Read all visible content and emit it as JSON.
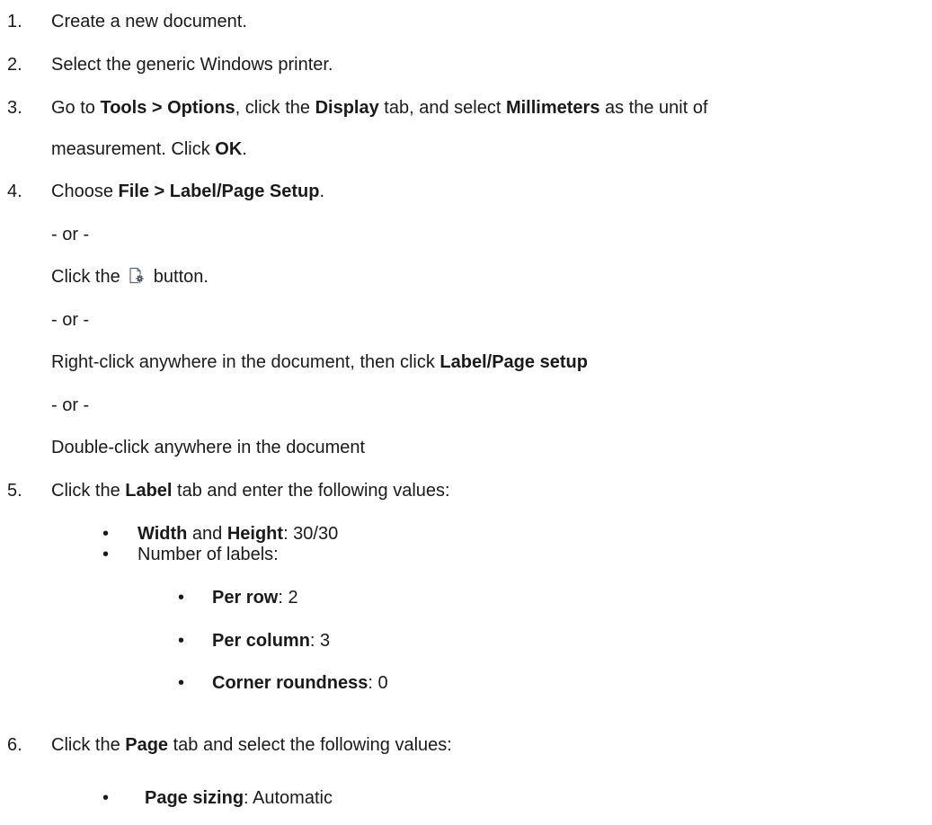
{
  "steps": [
    {
      "num": "1.",
      "text": "Create a new document."
    },
    {
      "num": "2.",
      "text": "Select the generic Windows printer."
    },
    {
      "num": "3.",
      "pre": "Go to ",
      "b1": "Tools > Options",
      "mid1": ", click the ",
      "b2": "Display",
      "mid2": " tab, and select ",
      "b3": "Millimeters",
      "post": " as the unit of",
      "line2_pre": "measurement. Click ",
      "line2_b": "OK",
      "line2_post": "."
    },
    {
      "num": "4.",
      "pre": "Choose ",
      "b": "File > Label/Page Setup",
      "post": ".",
      "or": "- or -",
      "click_pre": "Click the ",
      "click_post": " button.",
      "right_pre": "Right-click anywhere in the document, then click ",
      "right_b": "Label/Page setup",
      "double": "Double-click anywhere in the document"
    },
    {
      "num": "5.",
      "pre": "Click the ",
      "b": "Label",
      "post": " tab and enter the following values:",
      "bullets": {
        "wh_b1": "Width",
        "wh_mid": " and ",
        "wh_b2": "Height",
        "wh_post": ": 30/30",
        "num_labels": "Number of labels:",
        "per_row_b": "Per row",
        "per_row_v": ": 2",
        "per_col_b": "Per column",
        "per_col_v": ": 3",
        "corner_b": "Corner roundness",
        "corner_v": ": 0"
      }
    },
    {
      "num": "6.",
      "pre": "Click the ",
      "b": "Page",
      "post": " tab and select the following values:",
      "bullets": {
        "sizing_b": "Page sizing",
        "sizing_v": ": Automatic"
      }
    }
  ],
  "bullet_glyph": "•",
  "icon": "label-page-setup-icon"
}
